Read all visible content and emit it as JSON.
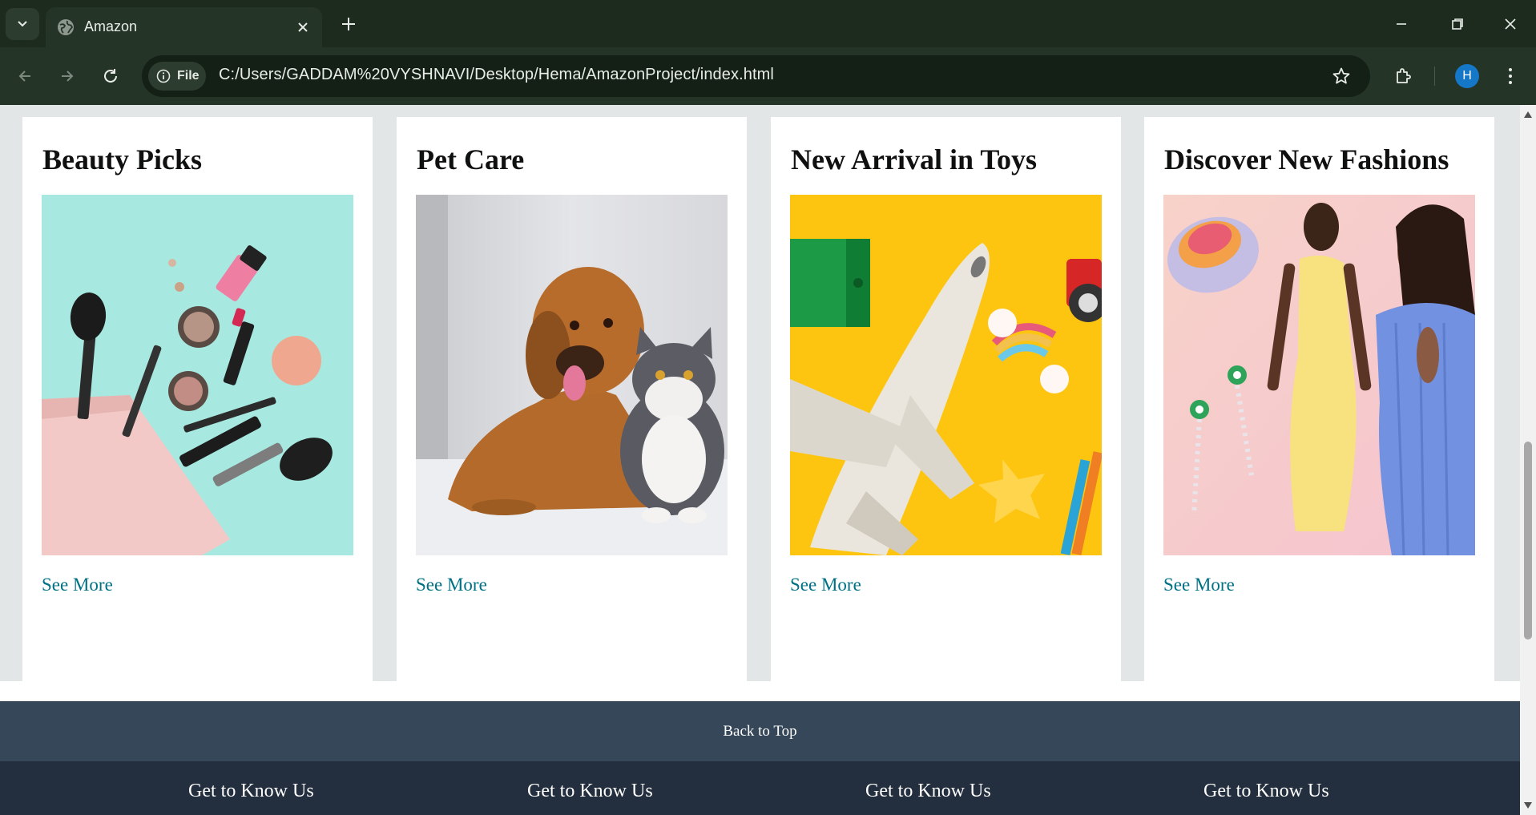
{
  "browser": {
    "tab_title": "Amazon",
    "url": "C:/Users/GADDAM%20VYSHNAVI/Desktop/Hema/AmazonProject/index.html",
    "site_chip_label": "File",
    "profile_initial": "H"
  },
  "cards": [
    {
      "title": "Beauty Picks",
      "link": "See More",
      "image": "makeup-flatlay"
    },
    {
      "title": "Pet Care",
      "link": "See More",
      "image": "dog-and-cat"
    },
    {
      "title": "New Arrival in Toys",
      "link": "See More",
      "image": "toy-airplane"
    },
    {
      "title": "Discover New Fashions",
      "link": "See More",
      "image": "fashion-models"
    }
  ],
  "back_to_top": "Back to Top",
  "footer": {
    "columns": [
      {
        "heading": "Get to Know Us"
      },
      {
        "heading": "Get to Know Us"
      },
      {
        "heading": "Get to Know Us"
      },
      {
        "heading": "Get to Know Us"
      }
    ]
  },
  "colors": {
    "link": "#007185",
    "back_to_top_bg": "#37475a",
    "footer_bg": "#232f3e",
    "page_bg": "#e3e6e6",
    "chrome_bg": "#1c2b1e"
  }
}
